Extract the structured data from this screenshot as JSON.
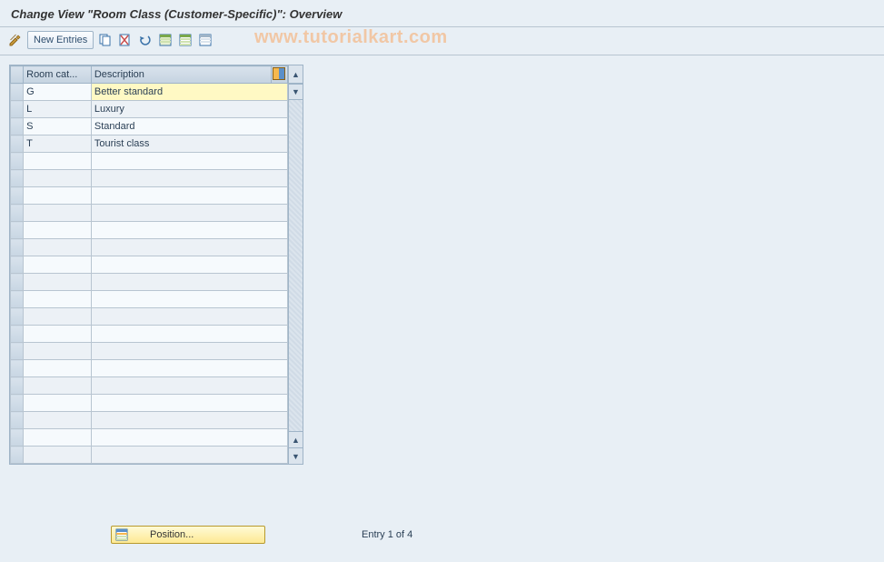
{
  "title": "Change View \"Room Class (Customer-Specific)\": Overview",
  "toolbar": {
    "new_entries": "New Entries"
  },
  "watermark": "www.tutorialkart.com",
  "table": {
    "headers": {
      "cat": "Room cat...",
      "desc": "Description"
    },
    "rows": [
      {
        "cat": "G",
        "desc": "Better standard"
      },
      {
        "cat": "L",
        "desc": "Luxury"
      },
      {
        "cat": "S",
        "desc": "Standard"
      },
      {
        "cat": "T",
        "desc": "Tourist class"
      }
    ]
  },
  "position_button": "Position...",
  "entry_status": "Entry 1 of 4"
}
